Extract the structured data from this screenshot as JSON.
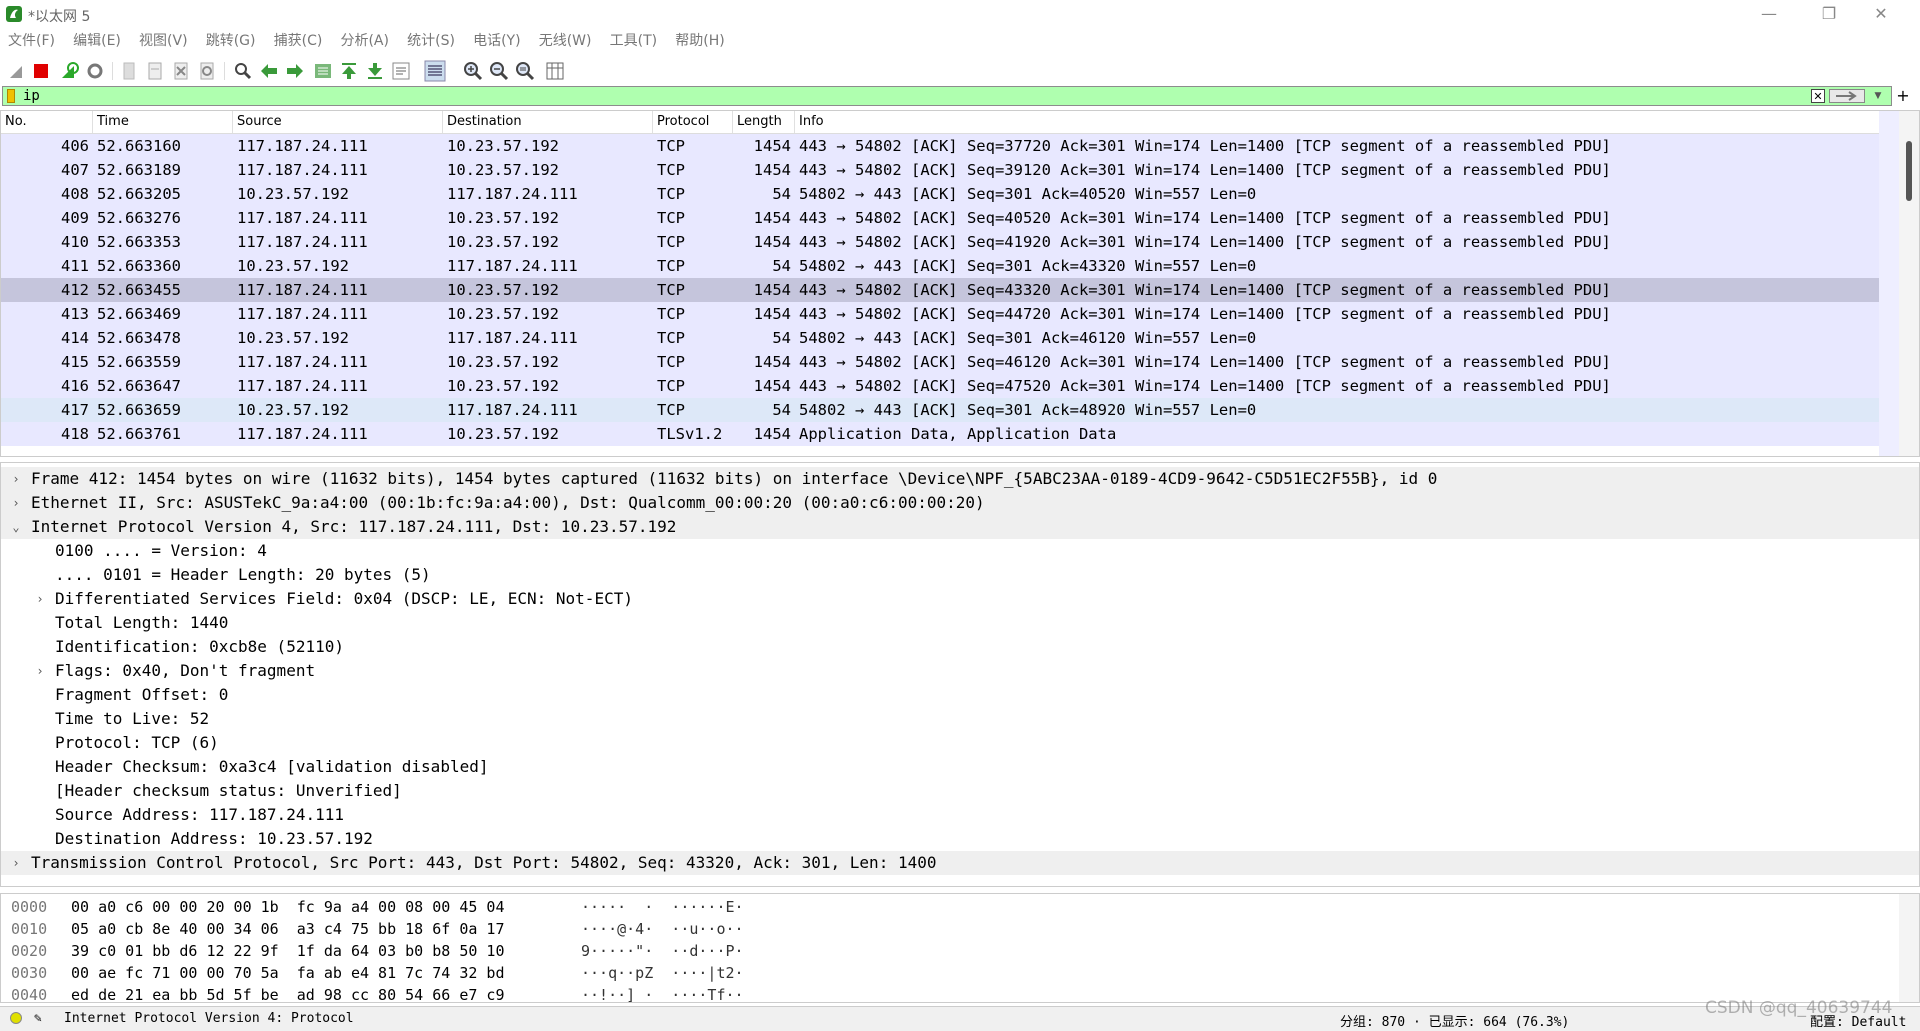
{
  "window": {
    "title": "*以太网 5",
    "controls": {
      "minimize": "—",
      "restore": "❐",
      "close": "✕"
    }
  },
  "menu": [
    "文件(F)",
    "编辑(E)",
    "视图(V)",
    "跳转(G)",
    "捕获(C)",
    "分析(A)",
    "统计(S)",
    "电话(Y)",
    "无线(W)",
    "工具(T)",
    "帮助(H)"
  ],
  "toolbar_icons": [
    "shark-fin-start-icon",
    "stop-capture-icon",
    "restart-capture-icon",
    "capture-options-icon",
    "open-file-icon",
    "save-file-icon",
    "close-file-icon",
    "reload-file-icon",
    "find-packet-icon",
    "go-back-icon",
    "go-forward-icon",
    "go-to-packet-icon",
    "go-first-icon",
    "go-last-icon",
    "auto-scroll-icon",
    "colorize-icon",
    "zoom-in-icon",
    "zoom-out-icon",
    "zoom-normal-icon",
    "resize-columns-icon"
  ],
  "filter": {
    "value": "ip",
    "plus": "+"
  },
  "columns": [
    "No.",
    "Time",
    "Source",
    "Destination",
    "Protocol",
    "Length",
    "Info"
  ],
  "packets": [
    {
      "no": "406",
      "time": "52.663160",
      "src": "117.187.24.111",
      "dst": "10.23.57.192",
      "proto": "TCP",
      "len": "1454",
      "info": "443 → 54802 [ACK] Seq=37720 Ack=301 Win=174 Len=1400 [TCP segment of a reassembled PDU]",
      "style": "plain"
    },
    {
      "no": "407",
      "time": "52.663189",
      "src": "117.187.24.111",
      "dst": "10.23.57.192",
      "proto": "TCP",
      "len": "1454",
      "info": "443 → 54802 [ACK] Seq=39120 Ack=301 Win=174 Len=1400 [TCP segment of a reassembled PDU]",
      "style": "plain"
    },
    {
      "no": "408",
      "time": "52.663205",
      "src": "10.23.57.192",
      "dst": "117.187.24.111",
      "proto": "TCP",
      "len": "54",
      "info": "54802 → 443 [ACK] Seq=301 Ack=40520 Win=557 Len=0",
      "style": "plain"
    },
    {
      "no": "409",
      "time": "52.663276",
      "src": "117.187.24.111",
      "dst": "10.23.57.192",
      "proto": "TCP",
      "len": "1454",
      "info": "443 → 54802 [ACK] Seq=40520 Ack=301 Win=174 Len=1400 [TCP segment of a reassembled PDU]",
      "style": "plain"
    },
    {
      "no": "410",
      "time": "52.663353",
      "src": "117.187.24.111",
      "dst": "10.23.57.192",
      "proto": "TCP",
      "len": "1454",
      "info": "443 → 54802 [ACK] Seq=41920 Ack=301 Win=174 Len=1400 [TCP segment of a reassembled PDU]",
      "style": "plain"
    },
    {
      "no": "411",
      "time": "52.663360",
      "src": "10.23.57.192",
      "dst": "117.187.24.111",
      "proto": "TCP",
      "len": "54",
      "info": "54802 → 443 [ACK] Seq=301 Ack=43320 Win=557 Len=0",
      "style": "plain"
    },
    {
      "no": "412",
      "time": "52.663455",
      "src": "117.187.24.111",
      "dst": "10.23.57.192",
      "proto": "TCP",
      "len": "1454",
      "info": "443 → 54802 [ACK] Seq=43320 Ack=301 Win=174 Len=1400 [TCP segment of a reassembled PDU]",
      "style": "sel"
    },
    {
      "no": "413",
      "time": "52.663469",
      "src": "117.187.24.111",
      "dst": "10.23.57.192",
      "proto": "TCP",
      "len": "1454",
      "info": "443 → 54802 [ACK] Seq=44720 Ack=301 Win=174 Len=1400 [TCP segment of a reassembled PDU]",
      "style": "plain"
    },
    {
      "no": "414",
      "time": "52.663478",
      "src": "10.23.57.192",
      "dst": "117.187.24.111",
      "proto": "TCP",
      "len": "54",
      "info": "54802 → 443 [ACK] Seq=301 Ack=46120 Win=557 Len=0",
      "style": "plain"
    },
    {
      "no": "415",
      "time": "52.663559",
      "src": "117.187.24.111",
      "dst": "10.23.57.192",
      "proto": "TCP",
      "len": "1454",
      "info": "443 → 54802 [ACK] Seq=46120 Ack=301 Win=174 Len=1400 [TCP segment of a reassembled PDU]",
      "style": "plain"
    },
    {
      "no": "416",
      "time": "52.663647",
      "src": "117.187.24.111",
      "dst": "10.23.57.192",
      "proto": "TCP",
      "len": "1454",
      "info": "443 → 54802 [ACK] Seq=47520 Ack=301 Win=174 Len=1400 [TCP segment of a reassembled PDU]",
      "style": "plain"
    },
    {
      "no": "417",
      "time": "52.663659",
      "src": "10.23.57.192",
      "dst": "117.187.24.111",
      "proto": "TCP",
      "len": "54",
      "info": "54802 → 443 [ACK] Seq=301 Ack=48920 Win=557 Len=0",
      "style": "hl"
    },
    {
      "no": "418",
      "time": "52.663761",
      "src": "117.187.24.111",
      "dst": "10.23.57.192",
      "proto": "TLSv1.2",
      "len": "1454",
      "info": "Application Data, Application Data",
      "style": "plain"
    }
  ],
  "details": [
    {
      "text": "Frame 412: 1454 bytes on wire (11632 bits), 1454 bytes captured (11632 bits) on interface \\Device\\NPF_{5ABC23AA-0189-4CD9-9642-C5D51EC2F55B}, id 0",
      "arrow": "›",
      "indent": 0,
      "shade": true
    },
    {
      "text": "Ethernet II, Src: ASUSTekC_9a:a4:00 (00:1b:fc:9a:a4:00), Dst: Qualcomm_00:00:20 (00:a0:c6:00:00:20)",
      "arrow": "›",
      "indent": 0,
      "shade": true
    },
    {
      "text": "Internet Protocol Version 4, Src: 117.187.24.111, Dst: 10.23.57.192",
      "arrow": "⌄",
      "indent": 0,
      "shade": true
    },
    {
      "text": "0100 .... = Version: 4",
      "arrow": "",
      "indent": 1,
      "shade": false
    },
    {
      "text": ".... 0101 = Header Length: 20 bytes (5)",
      "arrow": "",
      "indent": 1,
      "shade": false
    },
    {
      "text": "Differentiated Services Field: 0x04 (DSCP: LE, ECN: Not-ECT)",
      "arrow": "›",
      "indent": 1,
      "shade": false
    },
    {
      "text": "Total Length: 1440",
      "arrow": "",
      "indent": 1,
      "shade": false
    },
    {
      "text": "Identification: 0xcb8e (52110)",
      "arrow": "",
      "indent": 1,
      "shade": false
    },
    {
      "text": "Flags: 0x40, Don't fragment",
      "arrow": "›",
      "indent": 1,
      "shade": false
    },
    {
      "text": "Fragment Offset: 0",
      "arrow": "",
      "indent": 1,
      "shade": false
    },
    {
      "text": "Time to Live: 52",
      "arrow": "",
      "indent": 1,
      "shade": false
    },
    {
      "text": "Protocol: TCP (6)",
      "arrow": "",
      "indent": 1,
      "shade": false
    },
    {
      "text": "Header Checksum: 0xa3c4 [validation disabled]",
      "arrow": "",
      "indent": 1,
      "shade": false
    },
    {
      "text": "[Header checksum status: Unverified]",
      "arrow": "",
      "indent": 1,
      "shade": false
    },
    {
      "text": "Source Address: 117.187.24.111",
      "arrow": "",
      "indent": 1,
      "shade": false
    },
    {
      "text": "Destination Address: 10.23.57.192",
      "arrow": "",
      "indent": 1,
      "shade": false
    },
    {
      "text": "Transmission Control Protocol, Src Port: 443, Dst Port: 54802, Seq: 43320, Ack: 301, Len: 1400",
      "arrow": "›",
      "indent": 0,
      "shade": true
    }
  ],
  "bytes": [
    {
      "off": "0000",
      "hex": "00 a0 c6 00 00 20 00 1b  fc 9a a4 00 08 00 45 04",
      "ascii": "·····  ·  ······E·"
    },
    {
      "off": "0010",
      "hex": "05 a0 cb 8e 40 00 34 06  a3 c4 75 bb 18 6f 0a 17",
      "ascii": "····@·4·  ··u··o··"
    },
    {
      "off": "0020",
      "hex": "39 c0 01 bb d6 12 22 9f  1f da 64 03 b0 b8 50 10",
      "ascii": "9·····\"·  ··d···P·"
    },
    {
      "off": "0030",
      "hex": "00 ae fc 71 00 00 70 5a  fa ab e4 81 7c 74 32 bd",
      "ascii": "···q··pZ  ····|t2·"
    },
    {
      "off": "0040",
      "hex": "ed de 21 ea bb 5d 5f be  ad 98 cc 80 54 66 e7 c9",
      "ascii": "··!··]_·  ····Tf··"
    }
  ],
  "status": {
    "edit_icon": "✎",
    "text": "Internet Protocol Version 4: Protocol",
    "packets": "分组: 870 · 已显示: 664 (76.3%)",
    "profile": "配置: Default",
    "watermark": "CSDN @qq_40639744"
  },
  "colors": {
    "filter_valid": "#afffaf",
    "row": "#e8e8ff",
    "row_selected": "#c5c5dc",
    "accent": "#2a8a2a"
  }
}
